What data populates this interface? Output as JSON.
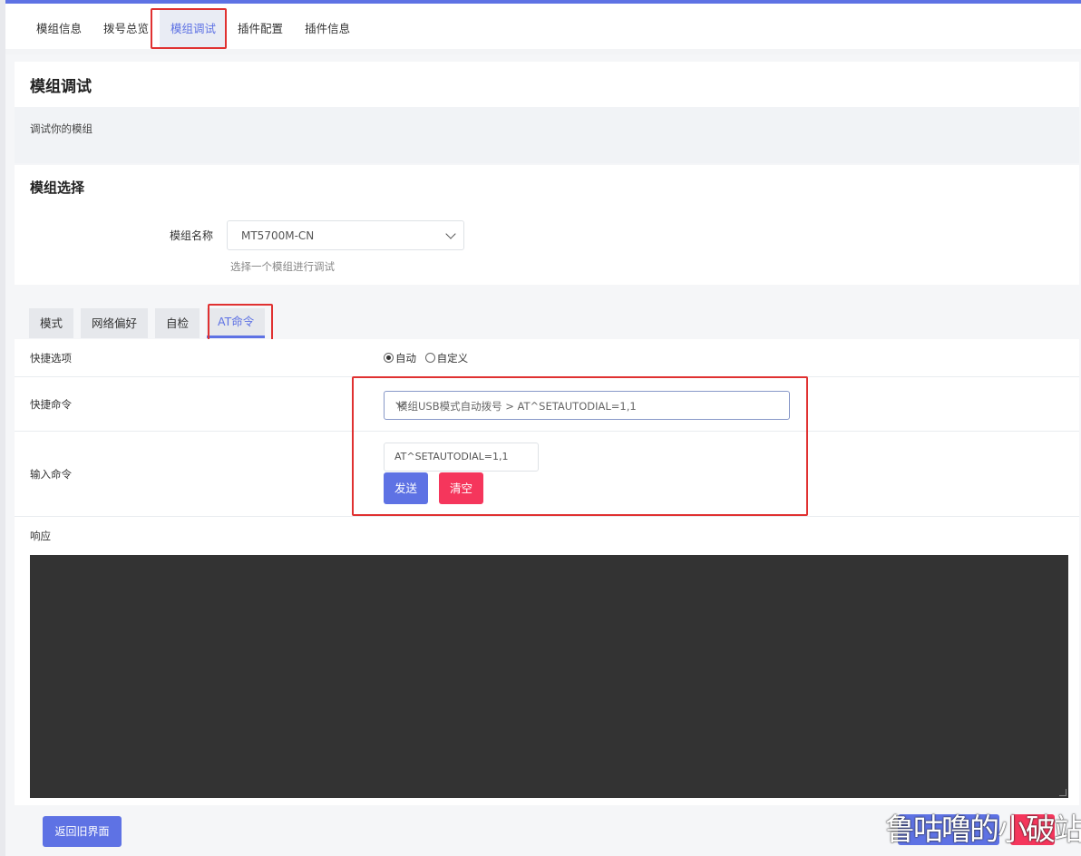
{
  "top_nav": {
    "tabs": [
      {
        "label": "模组信息"
      },
      {
        "label": "拨号总览"
      },
      {
        "label": "模组调试"
      },
      {
        "label": "插件配置"
      },
      {
        "label": "插件信息"
      }
    ]
  },
  "page": {
    "title": "模组调试",
    "description": "调试你的模组"
  },
  "module_select": {
    "title": "模组选择",
    "label": "模组名称",
    "value": "MT5700M-CN",
    "hint": "选择一个模组进行调试"
  },
  "sub_tabs": [
    {
      "label": "模式"
    },
    {
      "label": "网络偏好"
    },
    {
      "label": "自检"
    },
    {
      "label": "AT命令"
    }
  ],
  "at_form": {
    "quick_option_label": "快捷选项",
    "radio_auto": "自动",
    "radio_custom": "自定义",
    "quick_command_label": "快捷命令",
    "quick_command_value": "模组USB模式自动拨号 > AT^SETAUTODIAL=1,1",
    "input_label": "输入命令",
    "input_value": "AT^SETAUTODIAL=1,1",
    "send_label": "发送",
    "clear_label": "清空",
    "response_label": "响应"
  },
  "footer": {
    "legacy_label": "返回旧界面",
    "watermark": "鲁咕噜的小破站"
  }
}
